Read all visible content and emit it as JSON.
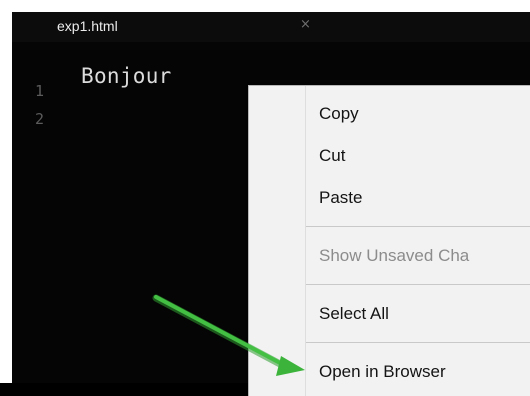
{
  "editor": {
    "tab": {
      "title": "exp1.html",
      "close_symbol": "×"
    },
    "line_numbers": [
      "1",
      "2"
    ],
    "code": "Bonjour"
  },
  "context_menu": {
    "items": [
      {
        "label": "Copy",
        "enabled": true
      },
      {
        "label": "Cut",
        "enabled": true
      },
      {
        "label": "Paste",
        "enabled": true
      },
      {
        "label": "Show Unsaved Cha",
        "enabled": false
      },
      {
        "label": "Select All",
        "enabled": true
      },
      {
        "label": "Open in Browser",
        "enabled": true
      }
    ]
  },
  "annotation": {
    "arrow_color": "#3cb43c",
    "points_to": "Open in Browser"
  },
  "colors": {
    "editor_background": "#050505",
    "menu_background": "#f2f2f2"
  }
}
